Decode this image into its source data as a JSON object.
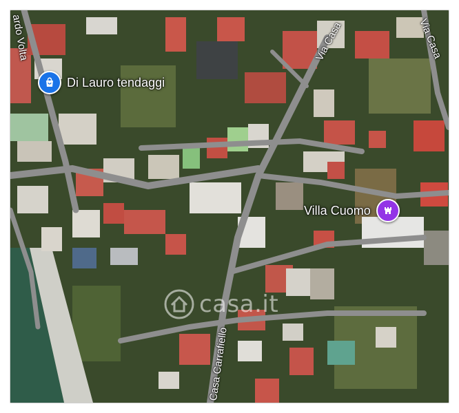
{
  "map": {
    "labels": {
      "volta": "ardo Volta",
      "via_casa": "Via Casa",
      "via_casa_right": "Via Casa",
      "carrafiello": "Casa Carrafiello"
    },
    "pois": {
      "shop": {
        "name": "Di Lauro tendaggi",
        "icon": "shopping-bag-icon",
        "color": "#1a73e8"
      },
      "villa": {
        "name": "Villa Cuomo",
        "icon": "castle-icon",
        "color": "#9334e6"
      }
    },
    "watermark": {
      "text": "casa.it",
      "icon": "house-logo-icon"
    }
  },
  "colors": {
    "vegetation": "#3b4a2c",
    "roads": "#8f8f8f",
    "sea": "#2e5e4a"
  }
}
